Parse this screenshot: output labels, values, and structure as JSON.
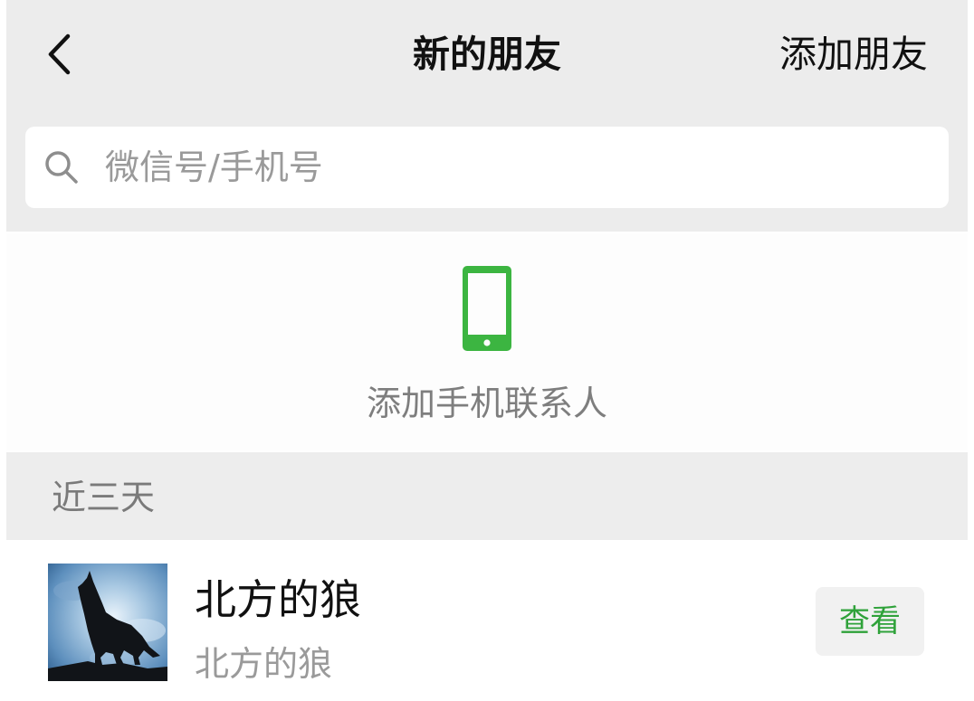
{
  "nav": {
    "back_icon": "chevron-left-icon",
    "title": "新的朋友",
    "action_label": "添加朋友"
  },
  "search": {
    "icon": "search-icon",
    "placeholder": "微信号/手机号",
    "value": ""
  },
  "add_phone_contacts": {
    "icon": "mobile-phone-icon",
    "label": "添加手机联系人"
  },
  "section": {
    "label": "近三天"
  },
  "requests": [
    {
      "name": "北方的狼",
      "message": "北方的狼",
      "avatar": "howling-wolf-avatar",
      "button_label": "查看"
    }
  ],
  "colors": {
    "nav_background": "#ececec",
    "section_background": "#ededed",
    "accent_green": "#2fa23a",
    "phone_icon_green": "#3cb541",
    "secondary_text": "#9a9a9a"
  }
}
